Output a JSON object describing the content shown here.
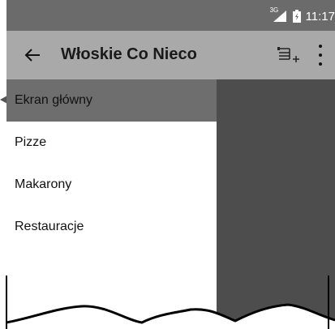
{
  "statusbar": {
    "network": "3G",
    "time": "11:17"
  },
  "appbar": {
    "title": "Włoskie Co Nieco",
    "back_icon": "arrow-back-icon",
    "action_icon": "add-to-playlist-icon",
    "overflow_icon": "more-vert-icon"
  },
  "drawer": {
    "items": [
      {
        "label": "Ekran główny",
        "active": true
      },
      {
        "label": "Pizze",
        "active": false
      },
      {
        "label": "Makarony",
        "active": false
      },
      {
        "label": "Restauracje",
        "active": false
      }
    ]
  },
  "colors": {
    "statusbar": "#6b6b6b",
    "appbar": "#a9a9a9",
    "active_item": "#6e6e6e",
    "scrim": "#4d4d4d"
  }
}
